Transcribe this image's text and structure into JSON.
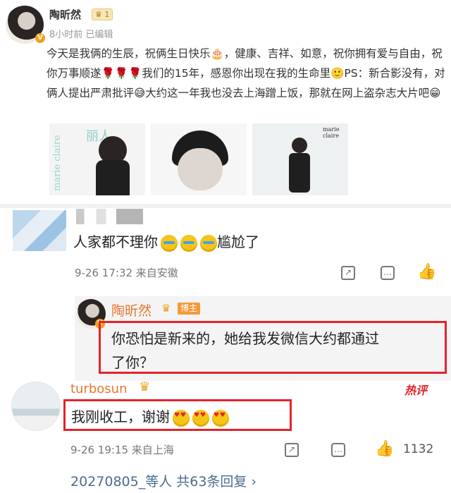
{
  "post": {
    "author": "陶昕然",
    "level": "1",
    "meta": "8小时前  已编辑",
    "text": "今天是我俩的生辰，祝俩生日快乐🎂，健康、吉祥、如意，祝你拥有爱与自由，祝你万事顺遂🌹🌹🌹我们的15年，感恩你出现在我的生命里🙂PS：新合影没有，对俩人提出严肃批评😅大约这一年我也没去上海蹭上饭，那就在网上盗杂志大片吧😁",
    "photos": [
      {
        "watermark": "marie claire",
        "overlay": "丽人"
      },
      {
        "watermark": "",
        "overlay": ""
      },
      {
        "watermark": "marie claire",
        "overlay": ""
      }
    ]
  },
  "comments": [
    {
      "text": "人家都不理你",
      "tail": "尴尬了",
      "meta": "9-26 17:32  来自安徽"
    },
    {
      "author": "陶昕然",
      "badge": "博主",
      "text_line1": "你恐怕是新来的，她给我发微信大约都通过",
      "text_line2": "了你？"
    },
    {
      "author": "turbosun",
      "hot": "热评",
      "text": "我刚收工，谢谢",
      "meta": "9-26 19:15  来自上海",
      "likes": "1132"
    }
  ],
  "more_replies": "20270805_等人  共63条回复 ›",
  "colors": {
    "accent": "#e6772e",
    "highlight_border": "#e2242b",
    "link": "#4d6b91"
  }
}
